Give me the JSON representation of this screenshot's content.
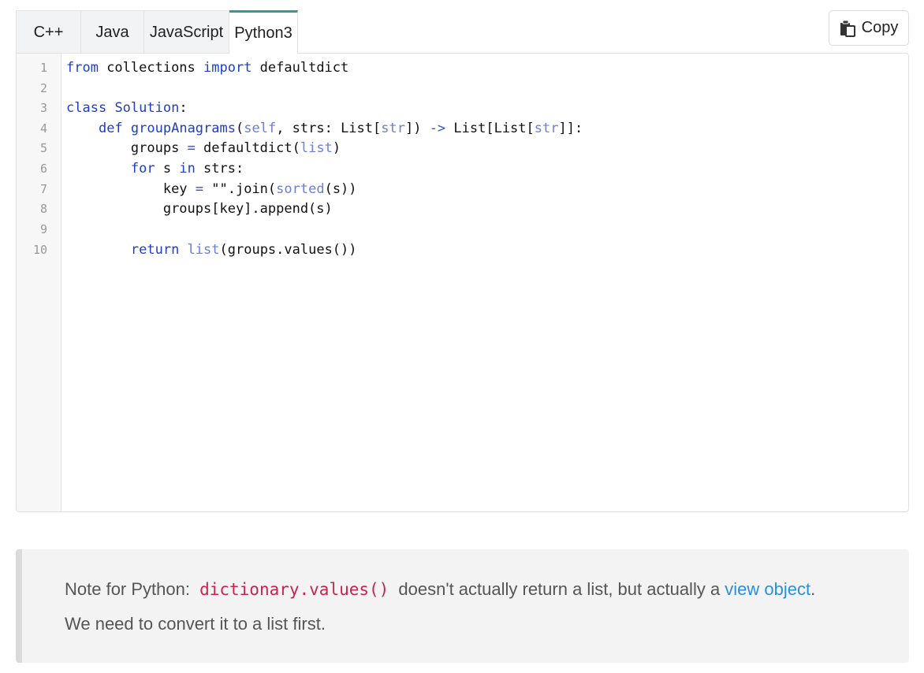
{
  "tabs": [
    {
      "label": "C++",
      "active": false
    },
    {
      "label": "Java",
      "active": false
    },
    {
      "label": "JavaScript",
      "active": false
    },
    {
      "label": "Python3",
      "active": true
    }
  ],
  "copy_button": {
    "label": "Copy",
    "icon": "copy-icon"
  },
  "code": {
    "language": "Python3",
    "line_numbers": [
      "1",
      "2",
      "3",
      "4",
      "5",
      "6",
      "7",
      "8",
      "9",
      "10"
    ],
    "lines": [
      "from collections import defaultdict",
      "",
      "class Solution:",
      "    def groupAnagrams(self, strs: List[str]) -> List[List[str]]:",
      "        groups = defaultdict(list)",
      "        for s in strs:",
      "            key = \"\".join(sorted(s))",
      "            groups[key].append(s)",
      "",
      "        return list(groups.values())"
    ],
    "tokens": {
      "l1": {
        "from": "from",
        "collections": " collections ",
        "import": "import",
        "defaultdict": " defaultdict"
      },
      "l3": {
        "class": "class",
        "name": "Solution",
        "colon": ":"
      },
      "l4": {
        "indent": "    ",
        "def": "def",
        "space": " ",
        "fname": "groupAnagrams",
        "p1": "(",
        "self": "self",
        "p2": ", strs: List[",
        "str1": "str",
        "p3": "]) ",
        "arrow": "->",
        "p4": " List[List[",
        "str2": "str",
        "p5": "]]:"
      },
      "l5": {
        "indent": "        ",
        "a": "groups ",
        "eq": "=",
        "b": " defaultdict(",
        "list": "list",
        "c": ")"
      },
      "l6": {
        "indent": "        ",
        "for": "for",
        "a": " s ",
        "in": "in",
        "b": " strs:"
      },
      "l7": {
        "indent": "            ",
        "a": "key ",
        "eq": "=",
        "b": " \"\".join(",
        "sorted": "sorted",
        "c": "(s))"
      },
      "l8": {
        "indent": "            ",
        "a": "groups[key].append(s)"
      },
      "l10": {
        "indent": "        ",
        "return": "return",
        "sp": " ",
        "list": "list",
        "a": "(groups.values())"
      }
    }
  },
  "note": {
    "prefix": "Note for Python: ",
    "code": "dictionary.values()",
    "middle": " doesn't actually return a list, but actually a ",
    "link": "view object",
    "suffix": ".",
    "line2": "We need to convert it to a list first."
  },
  "colors": {
    "accent_tab": "#2b9e94",
    "keyword": "#1e3ec7",
    "builtin": "#6a7fd6",
    "inline_code": "#c7254e",
    "link": "#2b8fdc"
  }
}
